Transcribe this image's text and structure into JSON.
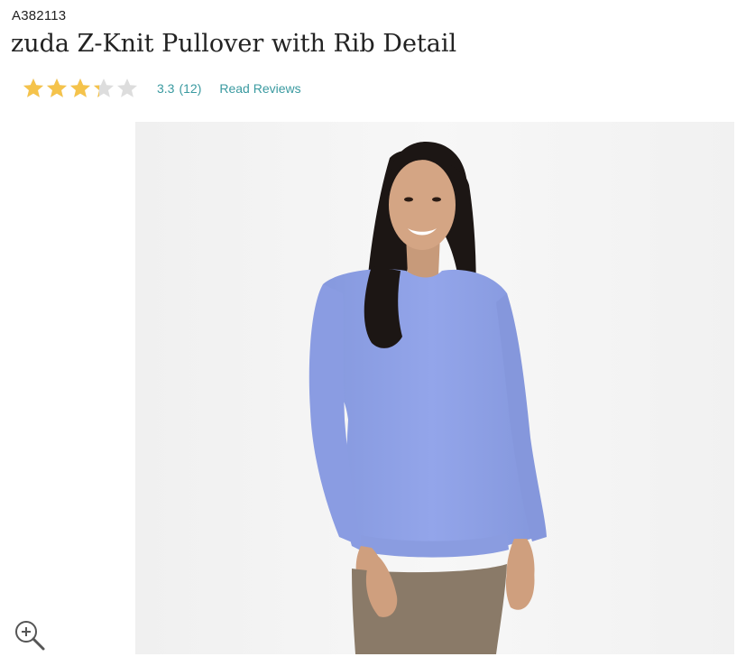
{
  "product": {
    "item_number": "A382113",
    "title": "zuda Z-Knit Pullover with Rib Detail"
  },
  "rating": {
    "value": 3.3,
    "value_label": "3.3",
    "count_label": "(12)",
    "max_stars": 5,
    "read_reviews_label": "Read Reviews",
    "star_color": "#f5c34b",
    "empty_star_color": "#dddddd",
    "link_color": "#3a9aa0"
  },
  "image": {
    "subject": "product-photo",
    "sweater_color": "#8fa2e6",
    "pants_color": "#8a7a68",
    "background_color": "#f3f3f3"
  },
  "zoom": {
    "icon": "zoom-in-icon"
  }
}
